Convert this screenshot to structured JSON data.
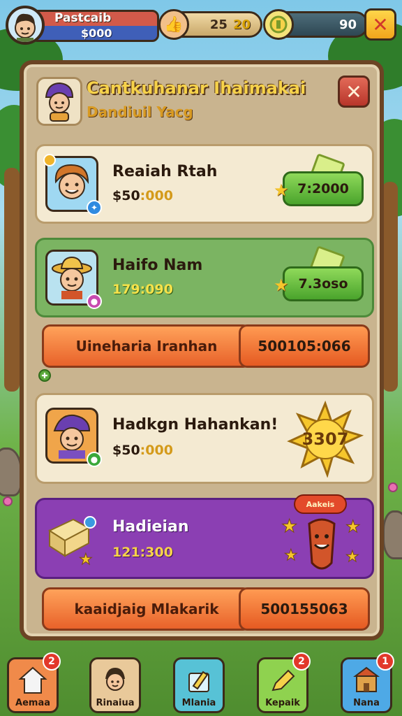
{
  "player": {
    "name": "Pastcaib",
    "money": "$000"
  },
  "stats": {
    "thumbs_value": "25",
    "thumbs_accent": "20",
    "coins_value": "90"
  },
  "panel": {
    "title": "Cantkuhanar Ihaimakai",
    "subtitle": "Dandiuil Yacg"
  },
  "cards": [
    {
      "name": "Reaiah Rtah",
      "value_prefix": "$50",
      "value_accent": ":000",
      "button": "7:2000"
    },
    {
      "name": "Haifo Nam",
      "value_prefix": "",
      "value_accent": "179:090",
      "button": "7.3oso"
    },
    {
      "name": "Hadkgn Hahankan!",
      "value_prefix": "$50",
      "value_accent": ":000",
      "badge": "3307"
    },
    {
      "name": "Hadieian",
      "value_prefix": "",
      "value_accent": "121:300",
      "award": "Aakeis"
    }
  ],
  "orange_bars": [
    {
      "label": "Uineharia Iranhan",
      "value": "500105:066"
    },
    {
      "label": "kaaidjaig Mlakarik",
      "value": "500155063"
    }
  ],
  "bottom_nav": [
    {
      "label": "Aemaa",
      "badge": "2",
      "icon": "house-icon",
      "color": "#f08a4a"
    },
    {
      "label": "Rinaiua",
      "badge": "",
      "icon": "character-icon",
      "color": "#e9c99a"
    },
    {
      "label": "Mlania",
      "badge": "",
      "icon": "build-icon",
      "color": "#57c2d6"
    },
    {
      "label": "Kepaik",
      "badge": "2",
      "icon": "pencil-icon",
      "color": "#8fd24f"
    },
    {
      "label": "Nana",
      "badge": "1",
      "icon": "shop-icon",
      "color": "#4ea9e6"
    }
  ]
}
